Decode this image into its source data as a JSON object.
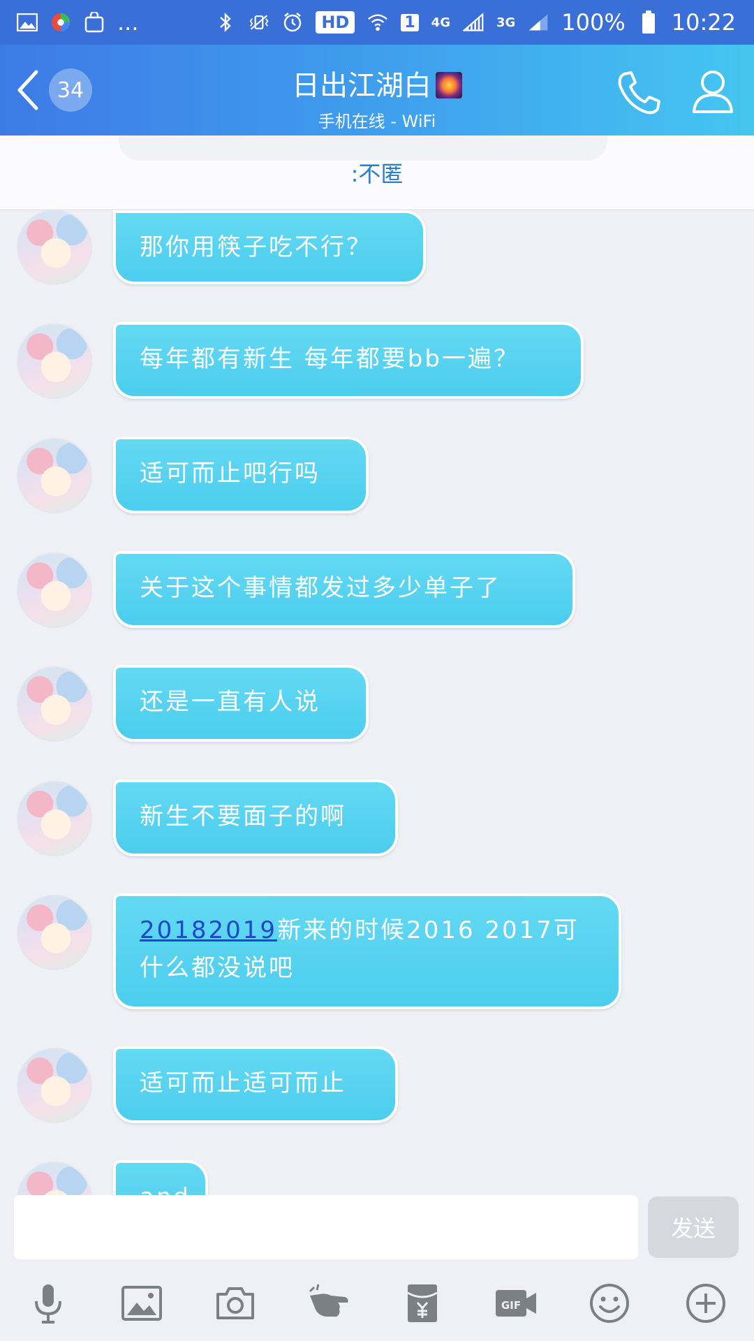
{
  "status_bar": {
    "more": "...",
    "hd": "HD",
    "sim": "1",
    "net1": "4G",
    "net2": "3G",
    "battery": "100%",
    "time": "10:22"
  },
  "header": {
    "badge_count": "34",
    "title": "日出江湖白",
    "subtitle": "手机在线 - WiFi"
  },
  "pinned": {
    "text": ":不匿"
  },
  "messages": [
    {
      "text": "那你用筷子吃不行？"
    },
    {
      "text": "每年都有新生 每年都要bb一遍？"
    },
    {
      "text": "适可而止吧行吗"
    },
    {
      "text": "关于这个事情都发过多少单子了"
    },
    {
      "text": "还是一直有人说"
    },
    {
      "text": "新生不要面子的啊"
    },
    {
      "highlight": "20182019",
      "text": "新来的时候2016 2017可什么都没说吧"
    },
    {
      "text": "适可而止适可而止"
    },
    {
      "text": "and"
    }
  ],
  "input": {
    "placeholder": "",
    "send_label": "发送"
  },
  "toolbar": [
    "mic-icon",
    "image-icon",
    "camera-icon",
    "poke-icon",
    "red-packet-icon",
    "gif-icon",
    "emoji-icon",
    "plus-icon"
  ],
  "colors": {
    "header_start": "#3d7ae6",
    "header_end": "#45c6f0",
    "bubble": "#55d1f0",
    "background": "#eef0f5"
  }
}
